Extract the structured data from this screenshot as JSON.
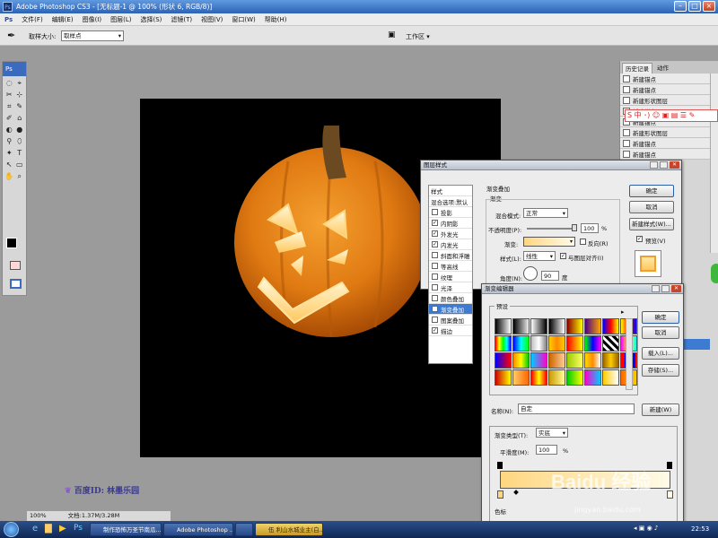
{
  "window": {
    "title": "Adobe Photoshop CS3 - [无标题-1 @ 100% (形状 6, RGB/8)]",
    "app_icon": "Ps"
  },
  "menu": [
    "文件(F)",
    "编辑(E)",
    "图像(I)",
    "图层(L)",
    "选择(S)",
    "滤镜(T)",
    "视图(V)",
    "窗口(W)",
    "帮助(H)"
  ],
  "options": {
    "sample_size_label": "取样大小:",
    "sample_size_value": "取样点",
    "workspace": "工作区 ▾"
  },
  "toolbox": {
    "header": "Ps",
    "tools": [
      "◌",
      "⌖",
      "✂",
      "⊹",
      "⌗",
      "✎",
      "✐",
      "⌂",
      "◐",
      "●",
      "⚲",
      "⬯",
      "✦",
      "T",
      "↖",
      "▭",
      "✋",
      "⌕"
    ]
  },
  "status": {
    "zoom": "100%",
    "doc": "文档:1.37M/3.28M"
  },
  "watermark": {
    "baidu_id": "百度ID: 林墨乐园",
    "jingyan": "Baidu 经验",
    "url": "jingyan.baidu.com"
  },
  "history": {
    "tabs": [
      "历史记录",
      "动作"
    ],
    "items": [
      "新建锚点",
      "新建锚点",
      "新建形状图层",
      "新建锚点",
      "新建锚点",
      "新建形状图层",
      "新建锚点",
      "新建锚点"
    ]
  },
  "layer_style": {
    "title": "图层样式",
    "section": "渐变叠加",
    "subsection": "渐变",
    "items": [
      {
        "label": "样式",
        "checked": null,
        "selected": false
      },
      {
        "label": "混合选项:默认",
        "checked": null,
        "selected": false
      },
      {
        "label": "投影",
        "checked": false,
        "selected": false
      },
      {
        "label": "内阴影",
        "checked": true,
        "selected": false
      },
      {
        "label": "外发光",
        "checked": true,
        "selected": false
      },
      {
        "label": "内发光",
        "checked": true,
        "selected": false
      },
      {
        "label": "斜面和浮雕",
        "checked": false,
        "selected": false
      },
      {
        "label": "等高线",
        "checked": false,
        "selected": false
      },
      {
        "label": "纹理",
        "checked": false,
        "selected": false
      },
      {
        "label": "光泽",
        "checked": false,
        "selected": false
      },
      {
        "label": "颜色叠加",
        "checked": false,
        "selected": false
      },
      {
        "label": "渐变叠加",
        "checked": true,
        "selected": true
      },
      {
        "label": "图案叠加",
        "checked": false,
        "selected": false
      },
      {
        "label": "描边",
        "checked": true,
        "selected": false
      }
    ],
    "blend_mode_label": "混合模式:",
    "blend_mode": "正常",
    "opacity_label": "不透明度(P):",
    "opacity": "100",
    "percent": "%",
    "gradient_label": "渐变:",
    "reverse_label": "反向(R)",
    "style_label": "样式(L):",
    "style_value": "线性",
    "align_label": "与图层对齐(I)",
    "angle_label": "角度(N):",
    "angle": "90",
    "degree": "度",
    "ok": "确定",
    "cancel": "取消",
    "new_style": "新建样式(W)...",
    "preview": "预览(V)"
  },
  "gradient_editor": {
    "title": "渐变编辑器",
    "presets_label": "预设",
    "name_label": "名称(N):",
    "name_value": "自定",
    "new_btn": "新建(W)",
    "type_label": "渐变类型(T):",
    "type_value": "实底",
    "smooth_label": "平滑度(M):",
    "smooth_value": "100",
    "percent": "%",
    "color_stop_label": "色标",
    "ok": "确定",
    "cancel": "取消",
    "load": "载入(L)...",
    "save": "存储(S)...",
    "swatch_colors": [
      "linear-gradient(90deg,#000,#fff)",
      "linear-gradient(90deg,#000,#0000)",
      "linear-gradient(90deg,#fff,#000)",
      "linear-gradient(90deg,#000,#fff)",
      "linear-gradient(90deg,#8b0000,#ff0)",
      "linear-gradient(90deg,#4b0082,#ffa500)",
      "linear-gradient(90deg,#00f,#f00,#ff0)",
      "linear-gradient(90deg,#ff0,#f00,#00f)",
      "linear-gradient(90deg,#f00,#ff0,#0f0,#0ff,#00f)",
      "linear-gradient(90deg,#00f,#0ff,#0f0)",
      "linear-gradient(90deg,#c0c0c0,#fff,#808080)",
      "linear-gradient(90deg,#fc0,#f80,#fc0)",
      "linear-gradient(90deg,#f00,#ff0)",
      "linear-gradient(90deg,#0f0,#00f,#f0f)",
      "repeating-linear-gradient(45deg,#000 0 3px,#fff 3px 6px)",
      "linear-gradient(90deg,#f0f,#ff0,#0ff)",
      "linear-gradient(90deg,#00f,#f00)",
      "linear-gradient(90deg,#f80,#ff0,#0c0)",
      "linear-gradient(90deg,#0cf,#f0c)",
      "linear-gradient(90deg,#c60,#fc9)",
      "linear-gradient(90deg,#9c0,#ff6)",
      "linear-gradient(90deg,#ffd700,#ff8c00,#fff)",
      "linear-gradient(90deg,#960,#fc0,#960)",
      "repeating-linear-gradient(90deg,#f00 0 4px,#00f 4px 8px)",
      "linear-gradient(90deg,#c00,#ff0)",
      "linear-gradient(90deg,#fc6,#f60)",
      "linear-gradient(90deg,#f00,#ff0,#f00)",
      "linear-gradient(90deg,#c90,#ff9)",
      "linear-gradient(90deg,#0c0,#ff0)",
      "linear-gradient(90deg,#f0c,#0cf)",
      "linear-gradient(90deg,#fc0,#fff)",
      "linear-gradient(90deg,#f60,#fc0)"
    ]
  },
  "taskbar": {
    "items": [
      "制作恐怖万圣节南瓜...",
      "Adobe Photoshop ...",
      "",
      "伍 利山水城业主(白..."
    ],
    "time": "22:53"
  },
  "colors": {
    "canvas": "#000000",
    "pumpkin": "#e07a12",
    "glow": "#ffd680",
    "selection": "#3d7ad1"
  }
}
